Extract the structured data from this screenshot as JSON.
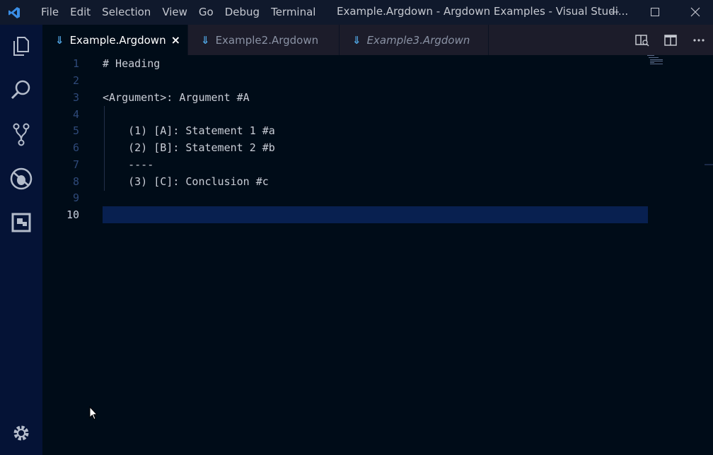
{
  "menu": [
    "File",
    "Edit",
    "Selection",
    "View",
    "Go",
    "Debug",
    "Terminal"
  ],
  "window_title": "Example.Argdown - Argdown Examples - Visual Studi...",
  "activity_bar": {
    "items": [
      "files-icon",
      "search-icon",
      "source-control-icon",
      "debug-icon",
      "extensions-icon"
    ],
    "bottom": "gear-icon"
  },
  "tabs": [
    {
      "label": "Example.Argdown",
      "active": true,
      "italic": false,
      "close": "×"
    },
    {
      "label": "Example2.Argdown",
      "active": false,
      "italic": false
    },
    {
      "label": "Example3.Argdown",
      "active": false,
      "italic": true
    }
  ],
  "tab_arrow": "⇓",
  "editor": {
    "current_line": 10,
    "lines": [
      {
        "n": "1",
        "text": "# Heading"
      },
      {
        "n": "2",
        "text": ""
      },
      {
        "n": "3",
        "text": "<Argument>: Argument #A"
      },
      {
        "n": "4",
        "text": ""
      },
      {
        "n": "5",
        "text": "    (1) [A]: Statement 1 #a"
      },
      {
        "n": "6",
        "text": "    (2) [B]: Statement 2 #b"
      },
      {
        "n": "7",
        "text": "    ----"
      },
      {
        "n": "8",
        "text": "    (3) [C]: Conclusion #c"
      },
      {
        "n": "9",
        "text": ""
      },
      {
        "n": "10",
        "text": ""
      }
    ]
  },
  "colors": {
    "editor_bg": "#000c18",
    "activity_bar_bg": "#051336",
    "current_line_bg": "#082050",
    "accent": "#4fa3e0"
  }
}
